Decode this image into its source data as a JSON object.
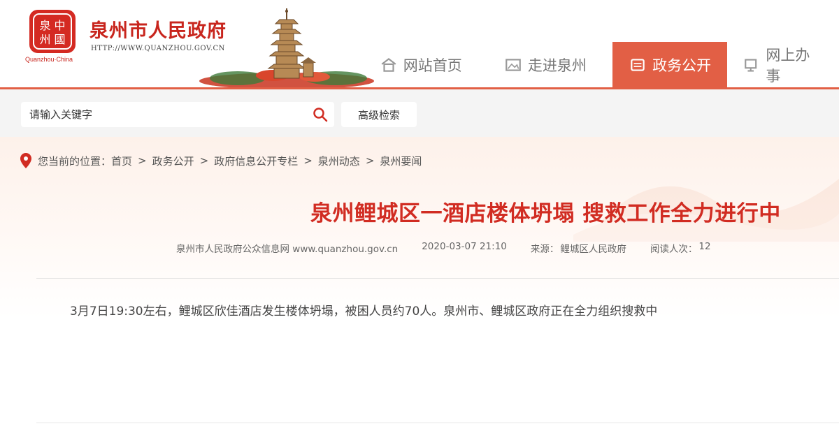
{
  "header": {
    "site_name": "泉州市人民政府",
    "site_url": "HTTP://WWW.QUANZHOU.GOV.CN",
    "logo_caption": "Quanzhou·China",
    "accent_color": "#e25f45",
    "title_color": "#c8251d"
  },
  "nav": {
    "items": [
      {
        "label": "网站首页",
        "icon": "home-icon"
      },
      {
        "label": "走进泉州",
        "icon": "landscape-icon"
      },
      {
        "label": "政务公开",
        "icon": "document-icon",
        "active": true
      },
      {
        "label": "网上办事",
        "icon": "monitor-icon"
      }
    ]
  },
  "search": {
    "placeholder": "请输入关键字",
    "advanced_label": "高级检索"
  },
  "breadcrumb": {
    "prefix": "您当前的位置：",
    "items": [
      "首页",
      "政务公开",
      "政府信息公开专栏",
      "泉州动态",
      "泉州要闻"
    ]
  },
  "article": {
    "title": "泉州鲤城区一酒店楼体坍塌 搜救工作全力进行中",
    "source_site": "泉州市人民政府公众信息网 www.quanzhou.gov.cn",
    "datetime": "2020-03-07 21:10",
    "source_label": "来源：",
    "source_value": "鲤城区人民政府",
    "views_label": "阅读人次：",
    "views_value": "12",
    "body": "3月7日19:30左右，鲤城区欣佳酒店发生楼体坍塌，被困人员约70人。泉州市、鲤城区政府正在全力组织搜救中"
  }
}
